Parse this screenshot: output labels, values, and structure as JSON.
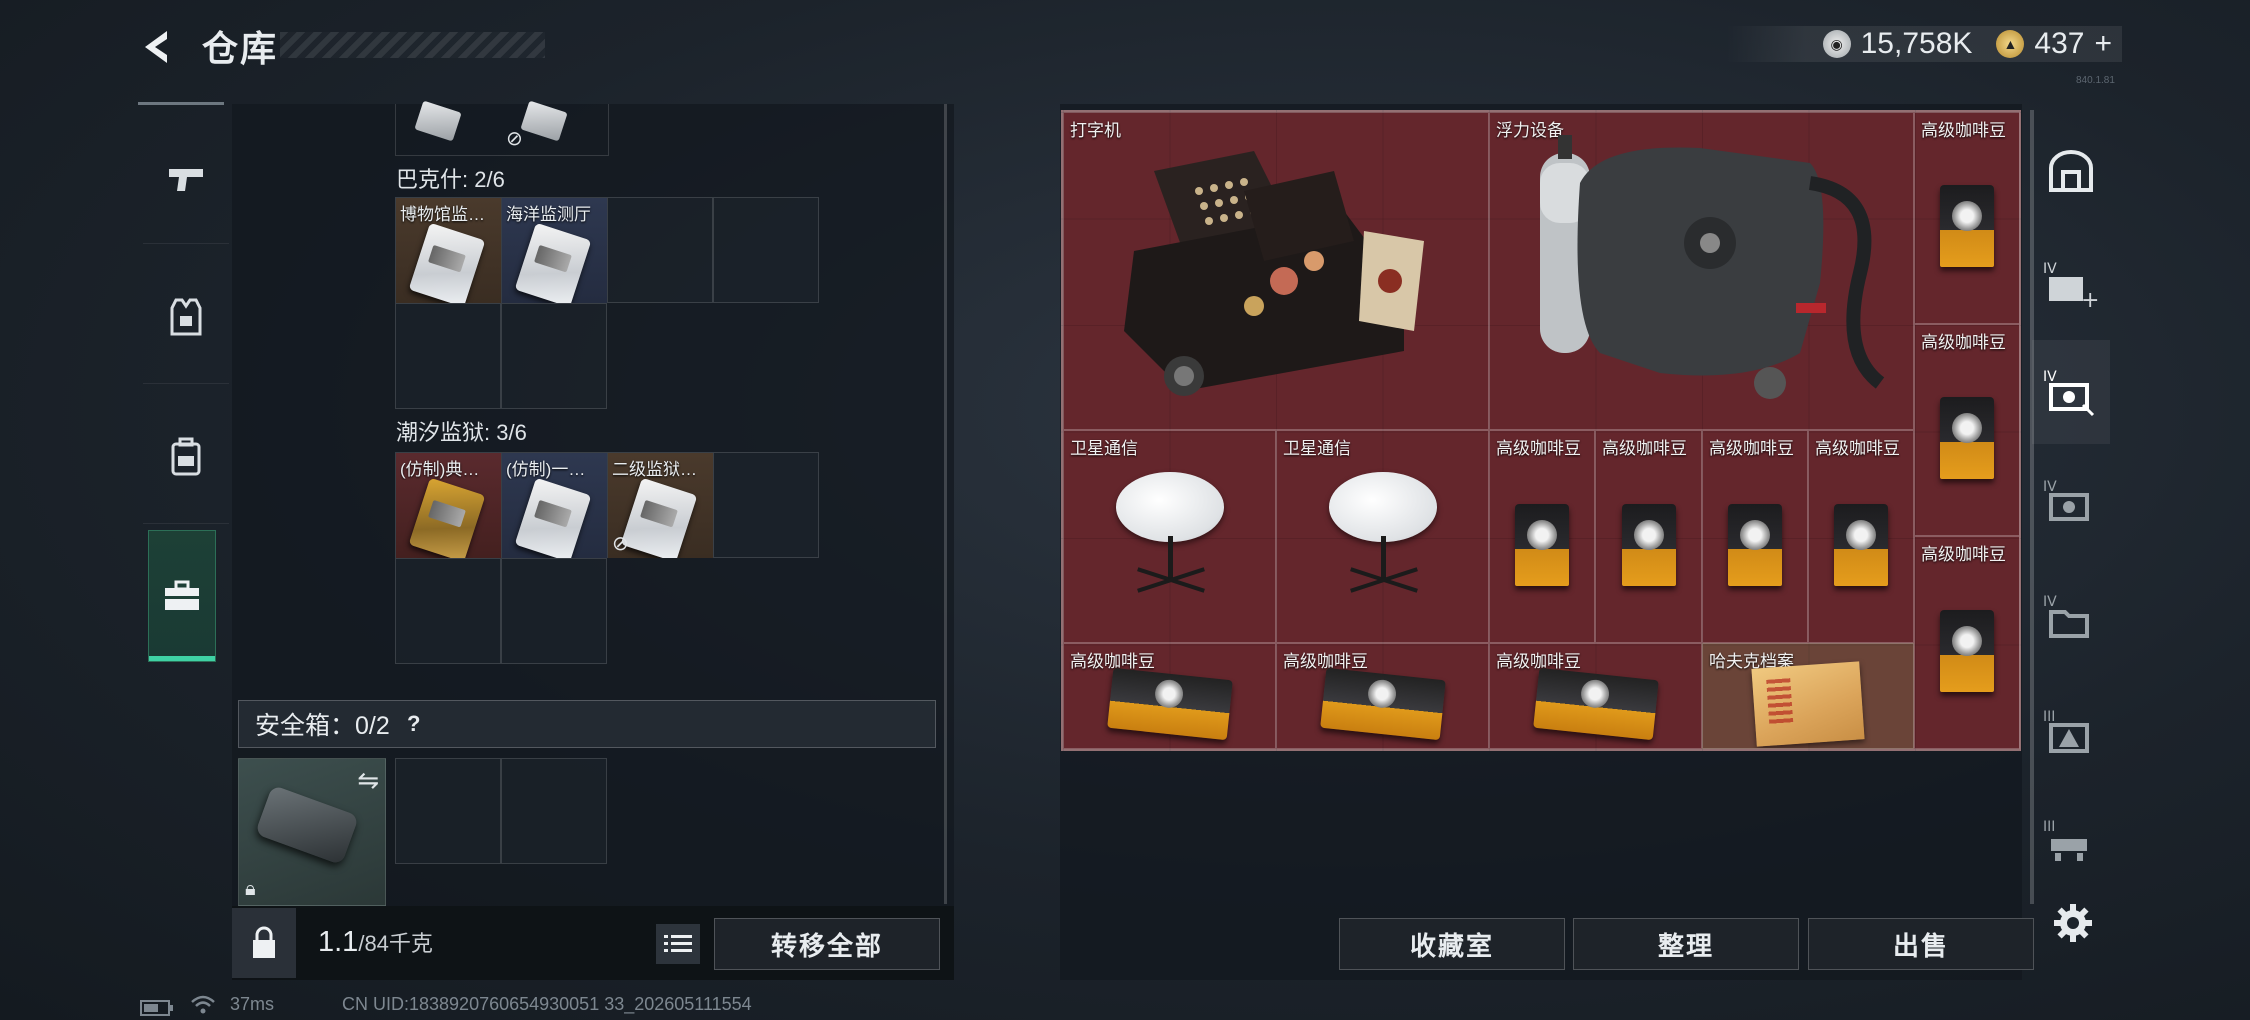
{
  "header": {
    "title": "仓库",
    "currency_primary": "15,758K",
    "currency_secondary": "437",
    "currency_add": "+",
    "version": "840.1.81"
  },
  "left_tabs": [
    {
      "name": "weapons",
      "icon": "pistol-icon"
    },
    {
      "name": "armor",
      "icon": "vest-icon"
    },
    {
      "name": "backpack",
      "icon": "backpack-icon"
    },
    {
      "name": "items",
      "icon": "toolbox-icon",
      "active": true
    }
  ],
  "left_panel": {
    "sections": [
      {
        "label": "巴克什: 2/6",
        "items": [
          "博物馆监…",
          "海洋监测厅"
        ]
      },
      {
        "label": "潮汐监狱: 3/6",
        "items": [
          "(仿制)典…",
          "(仿制)一…",
          "二级监狱…"
        ]
      }
    ],
    "safebox": {
      "label": "安全箱：0/2",
      "help": "?"
    },
    "weight_value": "1.1",
    "weight_unit": "/84千克",
    "transfer_all": "转移全部"
  },
  "stash": {
    "items": [
      {
        "label": "打字机"
      },
      {
        "label": "浮力设备"
      },
      {
        "label": "高级咖啡豆"
      },
      {
        "label": "高级咖啡豆"
      },
      {
        "label": "卫星通信"
      },
      {
        "label": "卫星通信"
      },
      {
        "label": "高级咖啡豆"
      },
      {
        "label": "高级咖啡豆"
      },
      {
        "label": "高级咖啡豆"
      },
      {
        "label": "高级咖啡豆"
      },
      {
        "label": "高级咖啡豆"
      },
      {
        "label": "高级咖啡豆"
      },
      {
        "label": "高级咖啡豆"
      },
      {
        "label": "高级咖啡豆"
      },
      {
        "label": "哈夫克档案"
      }
    ]
  },
  "bottom_buttons": {
    "collection": "收藏室",
    "organize": "整理",
    "sell": "出售"
  },
  "right_tabs": [
    {
      "icon": "stash-all-icon"
    },
    {
      "icon": "stash-add-icon",
      "tier": "IV"
    },
    {
      "icon": "stash-tier4-selected-icon",
      "tier": "IV",
      "active": true
    },
    {
      "icon": "stash-tier4-icon",
      "tier": "IV"
    },
    {
      "icon": "stash-tier4-folder-icon",
      "tier": "IV"
    },
    {
      "icon": "stash-tier3-warning-icon",
      "tier": "III"
    },
    {
      "icon": "stash-tier3-icon",
      "tier": "III"
    }
  ],
  "status_bar": {
    "ping": "37ms",
    "uid": "CN UID:1838920760654930051 33_202605111554"
  }
}
